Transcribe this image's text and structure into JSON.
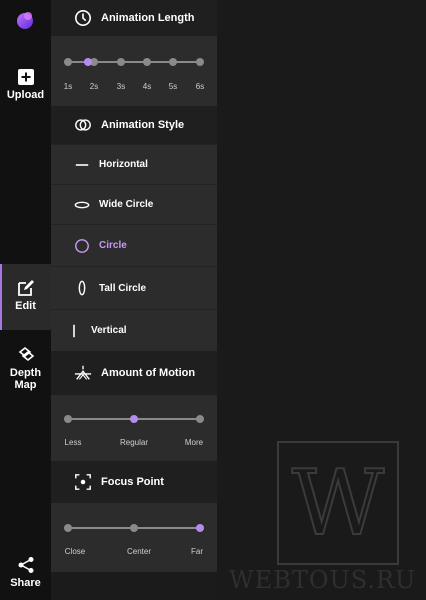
{
  "nav": {
    "upload": "Upload",
    "edit": "Edit",
    "depth_map_line1": "Depth",
    "depth_map_line2": "Map",
    "share": "Share"
  },
  "animation_length": {
    "title": "Animation Length",
    "ticks": [
      "1s",
      "2s",
      "3s",
      "4s",
      "5s",
      "6s"
    ],
    "selected_value": "1.7s"
  },
  "animation_style": {
    "title": "Animation Style",
    "options": [
      "Horizontal",
      "Wide Circle",
      "Circle",
      "Tall Circle",
      "Vertical"
    ],
    "selected": "Circle"
  },
  "amount_of_motion": {
    "title": "Amount of Motion",
    "ticks": [
      "Less",
      "Regular",
      "More"
    ],
    "selected": "Regular"
  },
  "focus_point": {
    "title": "Focus Point",
    "ticks": [
      "Close",
      "Center",
      "Far"
    ],
    "selected": "Far"
  },
  "colors": {
    "accent": "#b78af0",
    "panel": "#2c2c2c",
    "rail": "#111111"
  },
  "watermark": {
    "letter": "W",
    "text": "WEBTOUS.RU"
  }
}
